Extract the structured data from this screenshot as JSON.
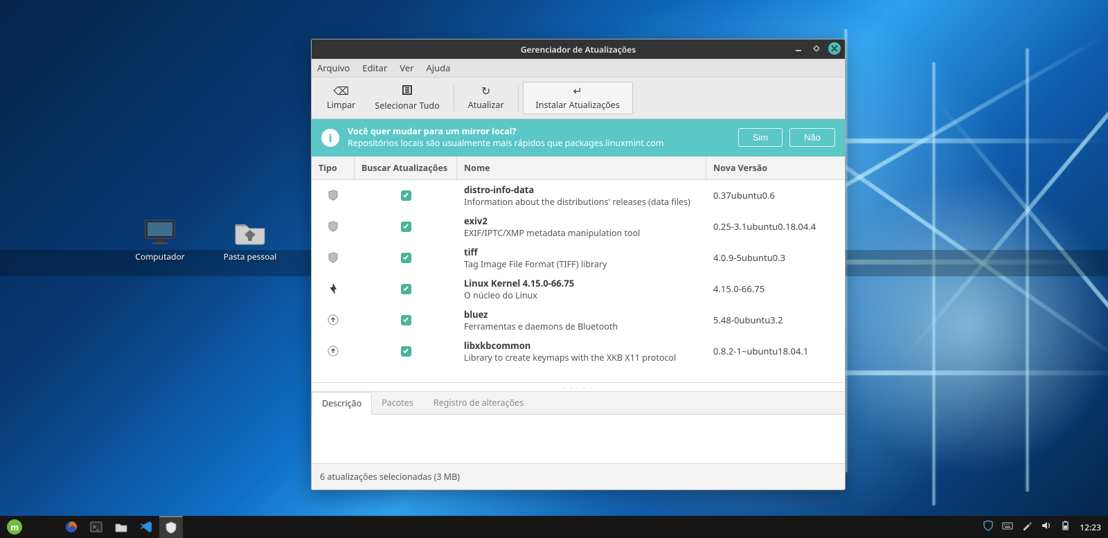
{
  "desktop": {
    "icons": [
      {
        "name": "computer",
        "label": "Computador"
      },
      {
        "name": "home",
        "label": "Pasta pessoal"
      }
    ]
  },
  "window": {
    "title": "Gerenciador de Atualizações",
    "menu": [
      "Arquivo",
      "Editar",
      "Ver",
      "Ajuda"
    ],
    "toolbar": {
      "clear": "Limpar",
      "select": "Selecionar Tudo",
      "refresh": "Atualizar",
      "install": "Instalar Atualizações"
    },
    "banner": {
      "title": "Você quer mudar para um mirror local?",
      "body": "Repositórios locais são usualmente mais rápidos que packages.linuxmint.com",
      "yes": "Sim",
      "no": "Não"
    },
    "columns": {
      "type": "Tipo",
      "checked": "Buscar Atualizações",
      "name": "Nome",
      "version": "Nova Versão"
    },
    "updates": [
      {
        "type": "shield",
        "checked": true,
        "name": "distro-info-data",
        "desc": "Information about the distributions' releases (data files)",
        "version": "0.37ubuntu0.6"
      },
      {
        "type": "shield",
        "checked": true,
        "name": "exiv2",
        "desc": "EXIF/IPTC/XMP metadata manipulation tool",
        "version": "0.25-3.1ubuntu0.18.04.4"
      },
      {
        "type": "shield",
        "checked": true,
        "name": "tiff",
        "desc": "Tag Image File Format (TIFF) library",
        "version": "4.0.9-5ubuntu0.3"
      },
      {
        "type": "kernel",
        "checked": true,
        "name": "Linux Kernel 4.15.0-66.75",
        "desc": "O núcleo do Linux",
        "version": "4.15.0-66.75"
      },
      {
        "type": "up",
        "checked": true,
        "name": "bluez",
        "desc": "Ferramentas e daemons de Bluetooth",
        "version": "5.48-0ubuntu3.2"
      },
      {
        "type": "up",
        "checked": true,
        "name": "libxkbcommon",
        "desc": "Library to create keymaps with the XKB X11 protocol",
        "version": "0.8.2-1~ubuntu18.04.1"
      }
    ],
    "detail_tabs": {
      "desc": "Descrição",
      "packages": "Pacotes",
      "changelog": "Registro de alterações"
    },
    "status": "6 atualizações selecionadas (3 MB)"
  },
  "panel": {
    "clock": "12:23"
  }
}
